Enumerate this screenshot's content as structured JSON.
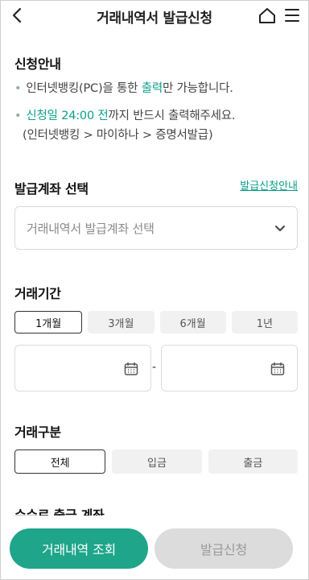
{
  "header": {
    "title": "거래내역서 발급신청"
  },
  "notice": {
    "heading": "신청안내",
    "line1_prefix": "인터넷뱅킹(PC)을 통한 ",
    "line1_highlight": "출력",
    "line1_suffix": "만 가능합니다.",
    "line2_highlight": "신청일 24:00 전",
    "line2_suffix": "까지 반드시 출력해주세요.",
    "line3": "(인터넷뱅킹 > 마이하나 > 증명서발급)"
  },
  "account": {
    "heading": "발급계좌 선택",
    "guide_link": "발급신청안내",
    "placeholder": "거래내역서 발급계좌 선택"
  },
  "period": {
    "heading": "거래기간",
    "options": [
      "1개월",
      "3개월",
      "6개월",
      "1년"
    ],
    "selected": "1개월",
    "separator": "-"
  },
  "type": {
    "heading": "거래구분",
    "options": [
      "전체",
      "입금",
      "출금"
    ],
    "selected": "전체"
  },
  "fee": {
    "heading": "수수료 출금 계좌"
  },
  "buttons": {
    "search": "거래내역 조회",
    "apply": "발급신청"
  }
}
